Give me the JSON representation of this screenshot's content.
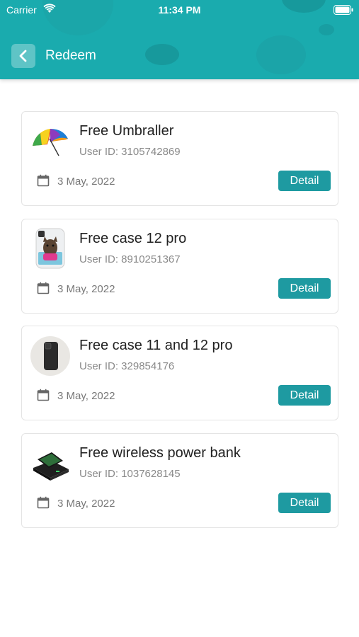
{
  "status_bar": {
    "carrier": "Carrier",
    "time": "11:34 PM"
  },
  "header": {
    "title": "Redeem"
  },
  "items": [
    {
      "title": "Free Umbraller",
      "user_id": "User ID: 3105742869",
      "date": "3 May, 2022",
      "button": "Detail",
      "thumb_icon": "umbrella-icon"
    },
    {
      "title": "Free case 12 pro",
      "user_id": "User ID: 8910251367",
      "date": "3 May, 2022",
      "button": "Detail",
      "thumb_icon": "phone-case-dog-icon"
    },
    {
      "title": "Free case 11 and 12 pro",
      "user_id": "User ID: 329854176",
      "date": "3 May, 2022",
      "button": "Detail",
      "thumb_icon": "phone-case-black-icon"
    },
    {
      "title": "Free wireless power bank",
      "user_id": "User ID: 1037628145",
      "date": "3 May, 2022",
      "button": "Detail",
      "thumb_icon": "power-bank-icon"
    }
  ],
  "colors": {
    "header": "#1aabae",
    "button": "#1e9aa1"
  }
}
